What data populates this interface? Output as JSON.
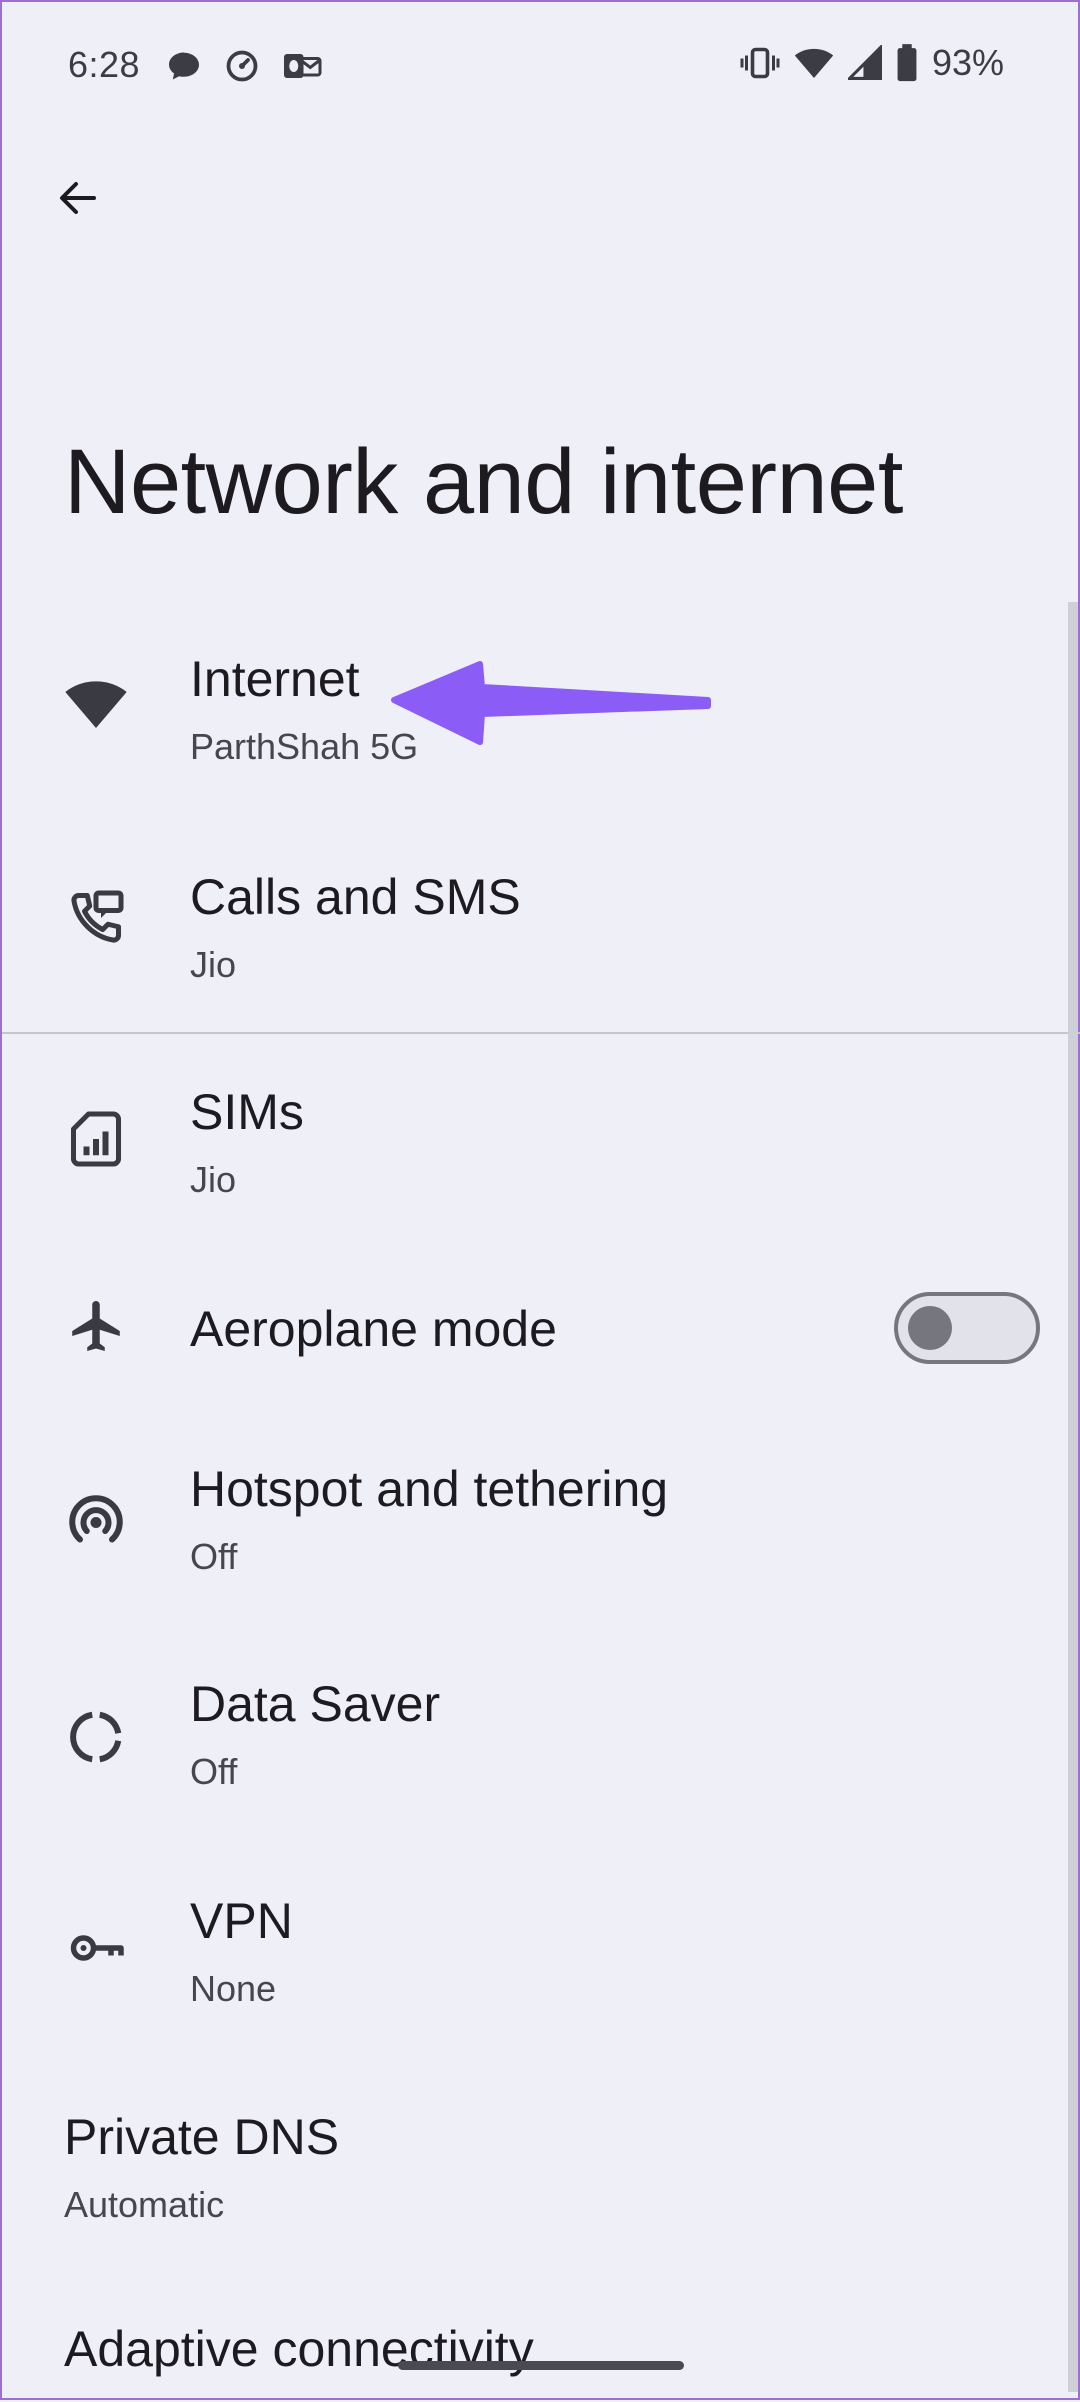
{
  "status_bar": {
    "time": "6:28",
    "battery": "93%",
    "left_icons": [
      "chat-icon",
      "speedometer-icon",
      "outlook-icon"
    ],
    "right_icons": [
      "vibrate-icon",
      "wifi-icon",
      "signal-icon",
      "battery-icon"
    ]
  },
  "page": {
    "title": "Network and internet"
  },
  "items": [
    {
      "title": "Internet",
      "subtitle": "ParthShah 5G",
      "icon": "wifi-icon"
    },
    {
      "title": "Calls and SMS",
      "subtitle": "Jio",
      "icon": "phone-message-icon"
    },
    {
      "title": "SIMs",
      "subtitle": "Jio",
      "icon": "sim-card-icon"
    },
    {
      "title": "Aeroplane mode",
      "icon": "airplane-icon",
      "toggle": false
    },
    {
      "title": "Hotspot and tethering",
      "subtitle": "Off",
      "icon": "hotspot-icon"
    },
    {
      "title": "Data Saver",
      "subtitle": "Off",
      "icon": "data-saver-icon"
    },
    {
      "title": "VPN",
      "subtitle": "None",
      "icon": "key-icon"
    },
    {
      "title": "Private DNS",
      "subtitle": "Automatic"
    },
    {
      "title": "Adaptive connectivity"
    }
  ],
  "colors": {
    "background": "#eeeff7",
    "annotation_arrow": "#8b5cf6",
    "toggle_off": "#76767f"
  }
}
